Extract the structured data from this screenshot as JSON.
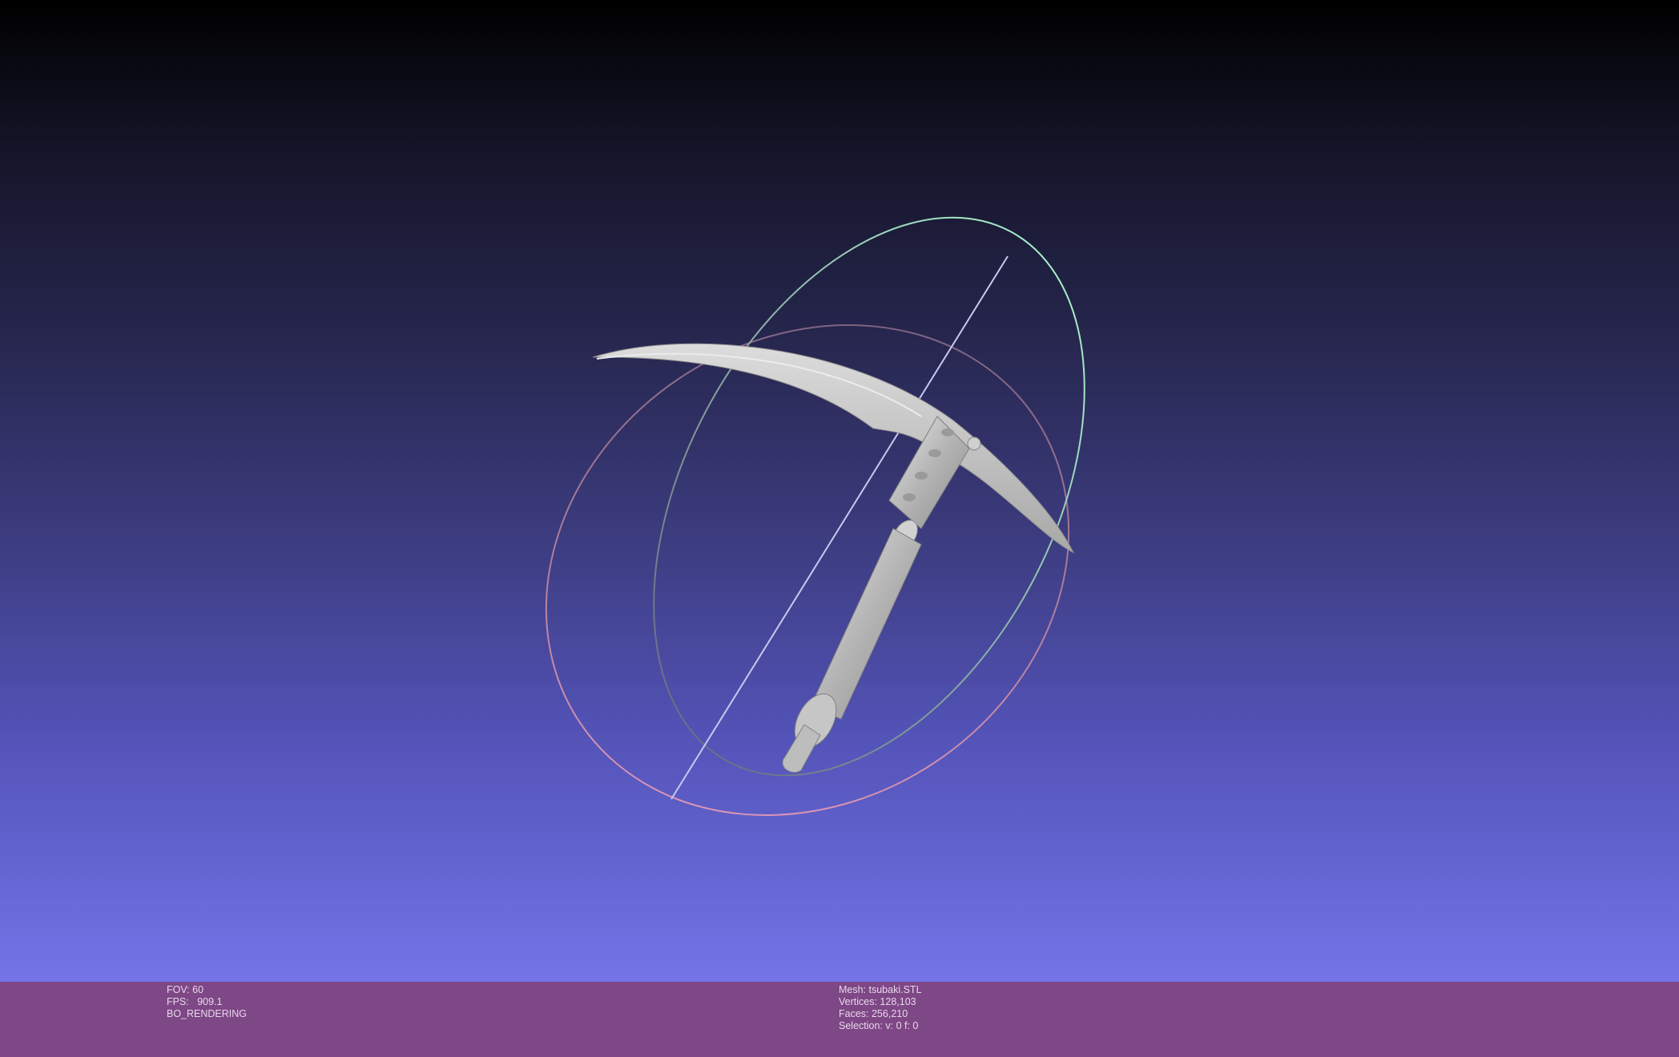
{
  "render_info": {
    "fov": "FOV: 60",
    "fps": "FPS:   909.1",
    "mode": "BO_RENDERING"
  },
  "mesh_info": {
    "mesh": "Mesh: tsubaki.STL",
    "vertices": "Vertices: 128,103",
    "faces": "Faces: 256,210",
    "selection": "Selection: v: 0 f: 0"
  },
  "colors": {
    "status_bar": "#7e4785",
    "model": "#b8b8b8",
    "trackball_x": "#d88aa8",
    "trackball_y": "#9ae0c0",
    "trackball_axis": "#c8c8f0"
  },
  "icons": {
    "model": "kusarigama-mesh",
    "trackball": "trackball-gizmo"
  }
}
